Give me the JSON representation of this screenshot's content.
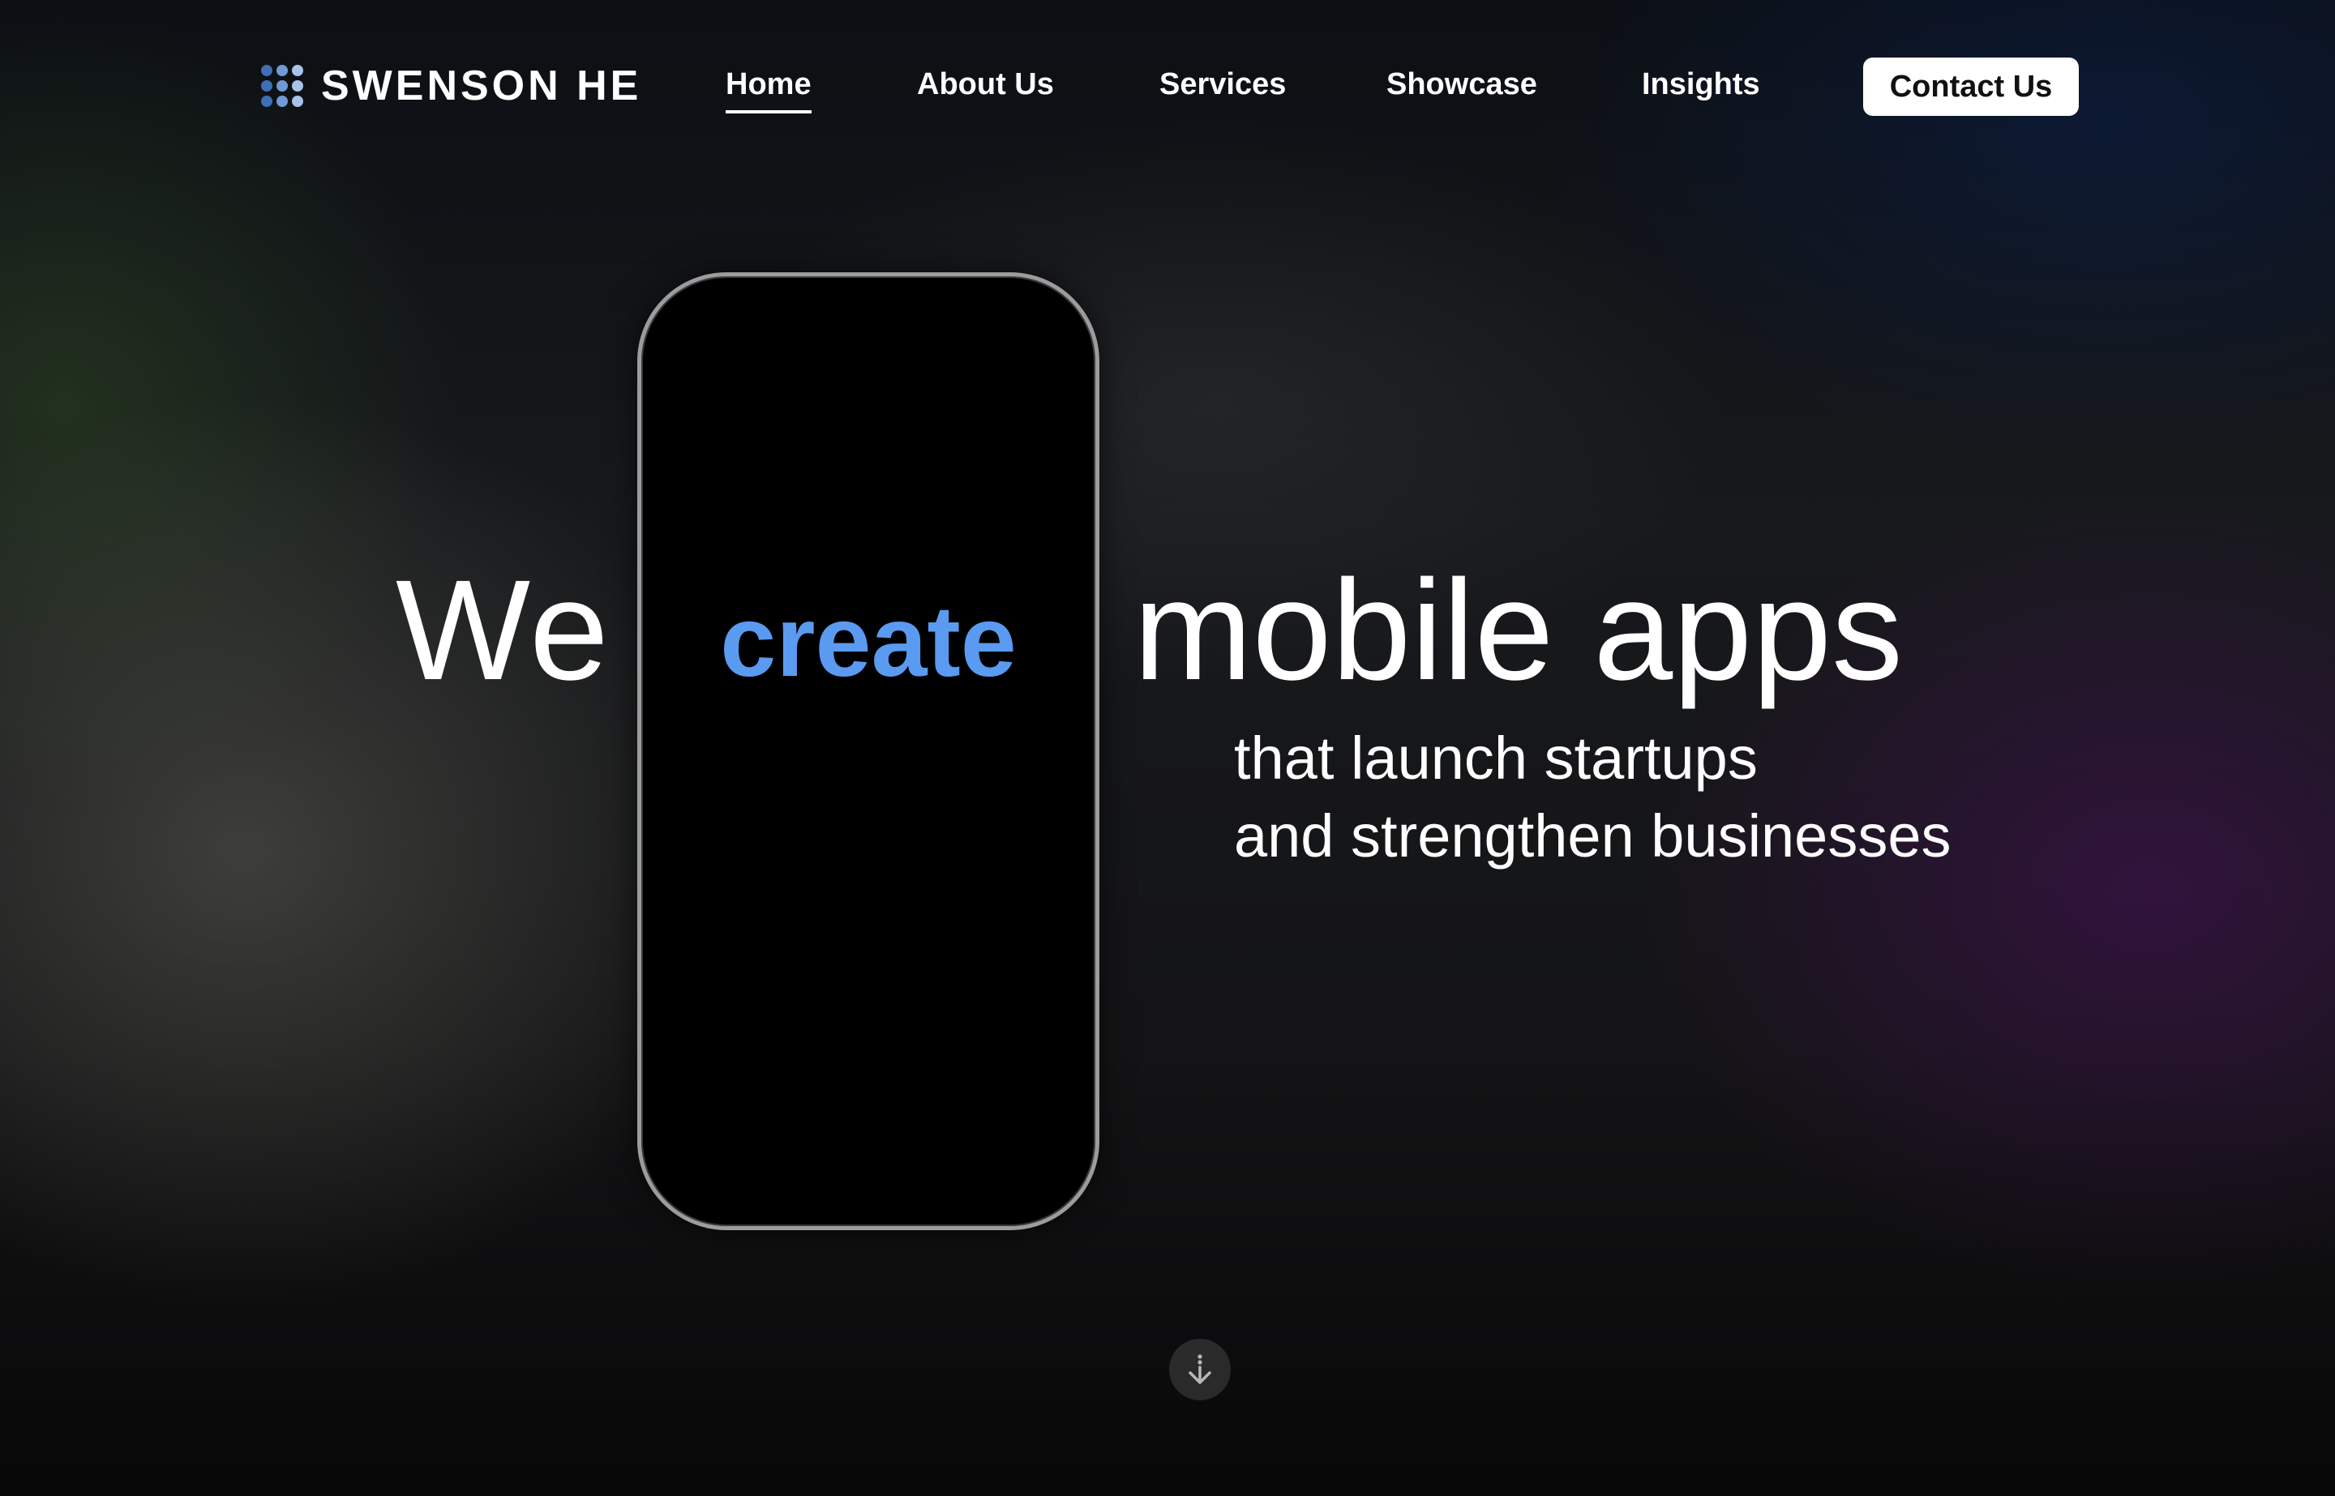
{
  "brand": {
    "name": "SWENSON HE",
    "logo_dot_colors": [
      "#3f6fb4",
      "#6f9ad6",
      "#a7c3ea",
      "#3f6fb4",
      "#6f9ad6",
      "#a7c3ea",
      "#3f6fb4",
      "#6f9ad6",
      "#a7c3ea"
    ]
  },
  "nav": {
    "items": [
      {
        "label": "Home",
        "active": true
      },
      {
        "label": "About Us",
        "active": false
      },
      {
        "label": "Services",
        "active": false
      },
      {
        "label": "Showcase",
        "active": false
      },
      {
        "label": "Insights",
        "active": false
      }
    ],
    "contact_label": "Contact Us"
  },
  "hero": {
    "word_we": "We",
    "word_create": "create",
    "word_mobile": "mobile apps",
    "sub_line_1": "that launch startups",
    "sub_line_2": "and strengthen businesses"
  },
  "scroll": {
    "icon": "scroll-down-arrow-icon"
  },
  "colors": {
    "accent": "#5a9af0",
    "text": "#ffffff",
    "button_bg": "#ffffff",
    "button_text": "#111111"
  }
}
